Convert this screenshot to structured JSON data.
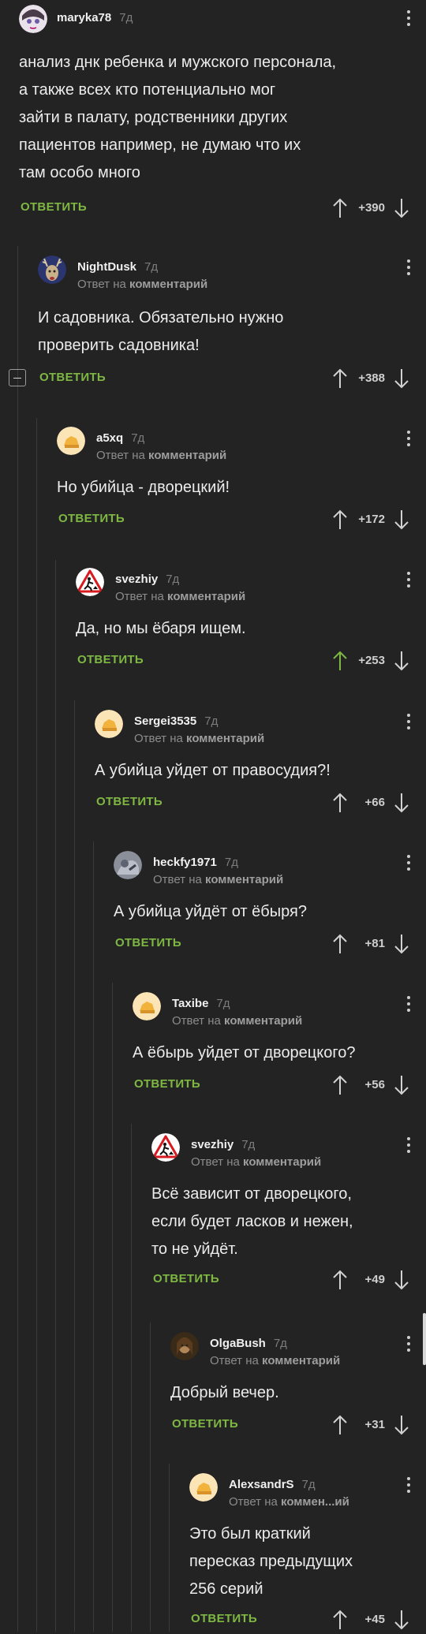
{
  "labels": {
    "reply": "ОТВЕТИТЬ",
    "reply_prefix": "Ответ на",
    "reply_target": "комментарий",
    "reply_target_short": "коммен...ий"
  },
  "colors": {
    "background": "#232323",
    "accent_green": "#7eb843",
    "thread_line": "#3a3a3a"
  },
  "comments": [
    {
      "user": "maryka78",
      "time": "7д",
      "avatar": "anime-avatar",
      "lines": [
        "анализ днк ребенка и мужского персонала,",
        "а также всех кто потенциально мог",
        "зайти в палату, родственники других",
        "пациентов например, не думаю что их",
        "там особо много"
      ],
      "rating": "+390",
      "upvoted": false
    },
    {
      "user": "NightDusk",
      "time": "7д",
      "avatar": "deer-avatar",
      "lines": [
        "И садовника. Обязательно нужно",
        "проверить садовника!"
      ],
      "rating": "+388",
      "upvoted": false
    },
    {
      "user": "a5xq",
      "time": "7д",
      "avatar": "default-avatar",
      "lines": [
        "Но убийца - дворецкий!"
      ],
      "rating": "+172",
      "upvoted": false
    },
    {
      "user": "svezhiy",
      "time": "7д",
      "avatar": "roadwork-sign-avatar",
      "lines": [
        "Да, но мы ёбаря ищем."
      ],
      "rating": "+253",
      "upvoted": true
    },
    {
      "user": "Sergei3535",
      "time": "7д",
      "avatar": "default-avatar",
      "lines": [
        "А убийца уйдет от правосудия?!"
      ],
      "rating": "+66",
      "upvoted": false
    },
    {
      "user": "heckfy1971",
      "time": "7д",
      "avatar": "photo-avatar",
      "lines": [
        "А убийца уйдёт от ёбыря?"
      ],
      "rating": "+81",
      "upvoted": false
    },
    {
      "user": "Taxibe",
      "time": "7д",
      "avatar": "default-avatar",
      "lines": [
        "А ёбырь уйдет от дворецкого?"
      ],
      "rating": "+56",
      "upvoted": false
    },
    {
      "user": "svezhiy",
      "time": "7д",
      "avatar": "roadwork-sign-avatar",
      "lines": [
        "Всё зависит от дворецкого,",
        "если будет ласков и нежен,",
        "то не уйдёт."
      ],
      "rating": "+49",
      "upvoted": false
    },
    {
      "user": "OlgaBush",
      "time": "7д",
      "avatar": "portrait-avatar",
      "lines": [
        "Добрый вечер."
      ],
      "rating": "+31",
      "upvoted": false
    },
    {
      "user": "AlexsandrS",
      "time": "7д",
      "avatar": "default-avatar",
      "lines": [
        "Это был краткий",
        "пересказ предыдущих",
        "256 серий"
      ],
      "rating": "+45",
      "upvoted": false
    }
  ]
}
